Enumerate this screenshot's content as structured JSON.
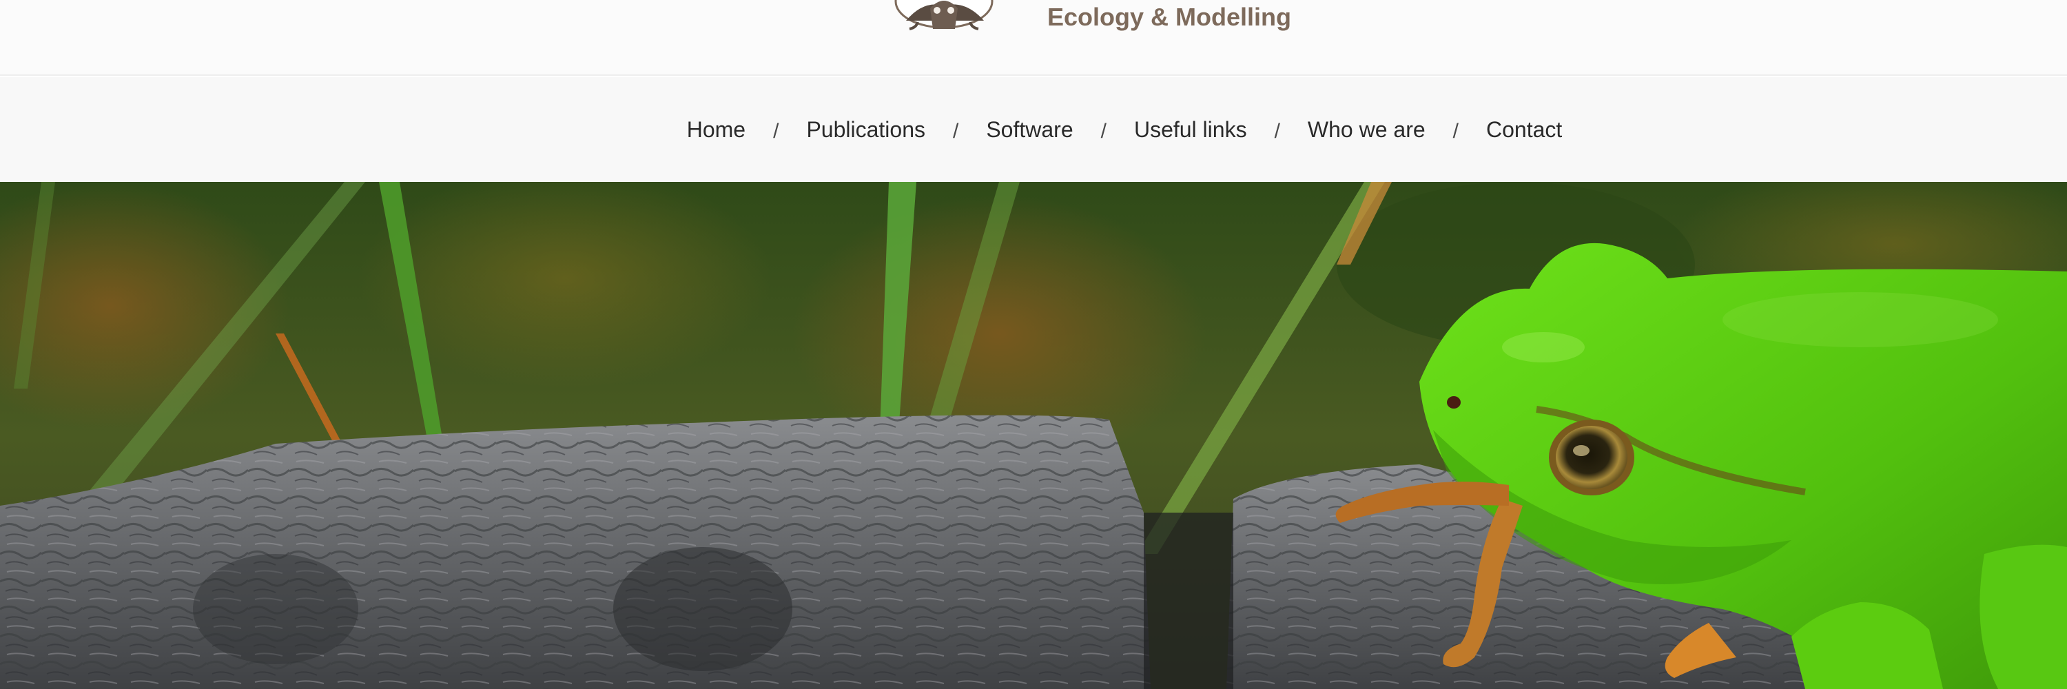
{
  "header": {
    "logo_text": "Ecology & Modelling",
    "logo_icon": "frog-logo-icon"
  },
  "nav": {
    "items": [
      {
        "label": "Home"
      },
      {
        "label": "Publications"
      },
      {
        "label": "Software"
      },
      {
        "label": "Useful links"
      },
      {
        "label": "Who we are"
      },
      {
        "label": "Contact"
      }
    ],
    "separator": "/"
  },
  "hero": {
    "subject": "green-tree-frog-photo"
  },
  "colors": {
    "logo_text": "#7d6a5b",
    "nav_text": "#2a2a2a",
    "frog_green": "#5ccc10",
    "bark_gray": "#6c6e70",
    "grass_bg": "#3a4a1c"
  }
}
